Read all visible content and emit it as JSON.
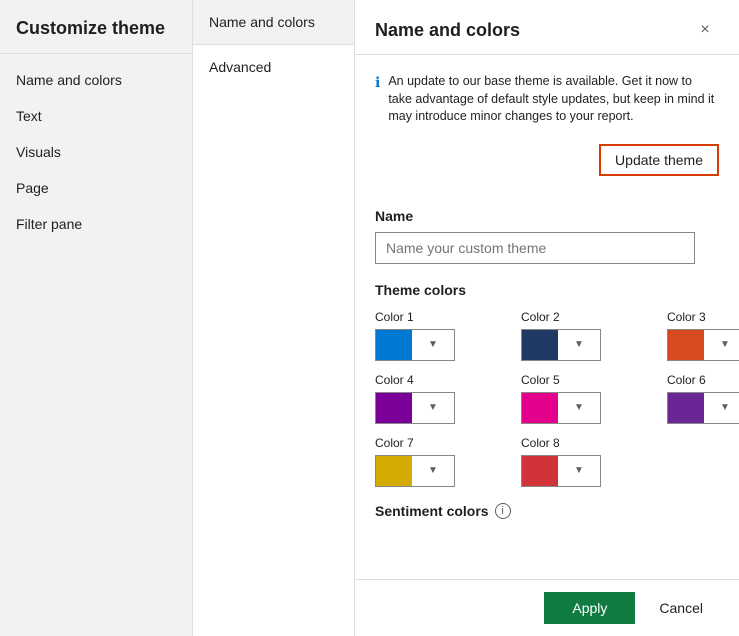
{
  "sidebar": {
    "title": "Customize theme",
    "nav_items": [
      {
        "label": "Name and colors",
        "active": true
      },
      {
        "label": "Text",
        "active": false
      },
      {
        "label": "Visuals",
        "active": false
      },
      {
        "label": "Page",
        "active": false
      },
      {
        "label": "Filter pane",
        "active": false
      }
    ]
  },
  "middle_panel": {
    "items": [
      {
        "label": "Name and colors",
        "active": true
      },
      {
        "label": "Advanced",
        "active": false
      }
    ]
  },
  "main": {
    "title": "Name and colors",
    "close_label": "×",
    "info_text": "An update to our base theme is available. Get it now to take advantage of default style updates, but keep in mind it may introduce minor changes to your report.",
    "update_theme_label": "Update theme",
    "name_section": {
      "label": "Name",
      "input_placeholder": "Name your custom theme",
      "input_value": ""
    },
    "theme_colors": {
      "title": "Theme colors",
      "colors": [
        {
          "label": "Color 1",
          "color": "#0078d4"
        },
        {
          "label": "Color 2",
          "color": "#1f3864"
        },
        {
          "label": "Color 3",
          "color": "#d84a1f"
        },
        {
          "label": "Color 4",
          "color": "#7b0099"
        },
        {
          "label": "Color 5",
          "color": "#e3008c"
        },
        {
          "label": "Color 6",
          "color": "#6b2696"
        },
        {
          "label": "Color 7",
          "color": "#d4a900"
        },
        {
          "label": "Color 8",
          "color": "#d13438"
        }
      ]
    },
    "sentiment_colors": {
      "title": "Sentiment colors"
    }
  },
  "footer": {
    "apply_label": "Apply",
    "cancel_label": "Cancel"
  }
}
